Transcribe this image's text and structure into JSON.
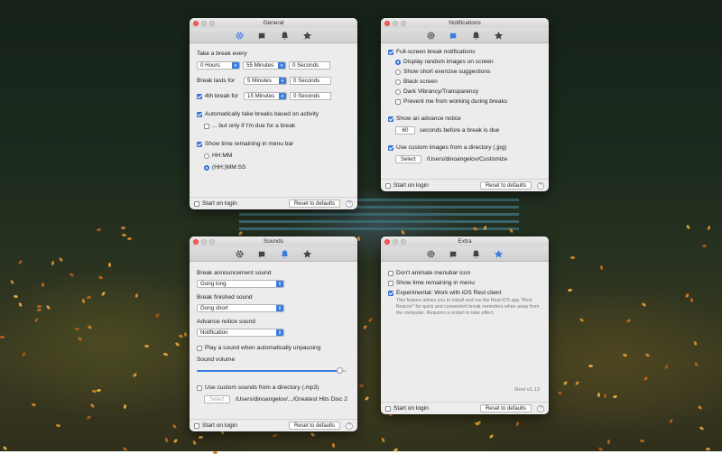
{
  "general": {
    "title": "General",
    "take_break_every_label": "Take a break every",
    "hours_value": "0 Hours",
    "minutes_value": "55 Minutes",
    "seconds_value": "0 Seconds",
    "break_lasts_label": "Break lasts for",
    "lasts_minutes_value": "5 Minutes",
    "lasts_seconds_value": "0 Seconds",
    "fourth_break_label": "4th break for",
    "fourth_minutes_value": "15 Minutes",
    "fourth_seconds_value": "0 Seconds",
    "auto_breaks_label": "Automatically take breaks based on activity",
    "only_if_due_label": "... but only if I'm due for a break",
    "show_time_label": "Show time remaining in menu bar",
    "format_hhmm": "HH:MM",
    "format_hhmmss": "(HH:)MM:SS",
    "start_on_login": "Start on login",
    "reset_defaults": "Reset to defaults",
    "help": "?"
  },
  "notifications": {
    "title": "Notifications",
    "fullscreen_label": "Full-screen break notifications",
    "opt_random_images": "Display random images on screen",
    "opt_exercise": "Show short exercise suggestions",
    "opt_black": "Black screen",
    "opt_vibrancy": "Dark Vibrancy/Transparency",
    "prevent_label": "Prevent me from working during breaks",
    "advance_notice_label": "Show an advance notice",
    "advance_seconds_value": "60",
    "advance_seconds_suffix": "seconds before a break is due",
    "custom_images_label": "Use custom images from a directory (.jpg)",
    "select_button": "Select",
    "images_path": "/Users/dinoangelov/Customize",
    "start_on_login": "Start on login",
    "reset_defaults": "Reset to defaults",
    "help": "?"
  },
  "sounds": {
    "title": "Sounds",
    "announcement_label": "Break announcement sound",
    "announcement_value": "Gong long",
    "finished_label": "Break finished sound",
    "finished_value": "Gong short",
    "advance_label": "Advance notice sound",
    "advance_value": "Notification",
    "unpausing_label": "Play a sound when automatically unpausing",
    "volume_label": "Sound volume",
    "volume_level": 0.98,
    "custom_sounds_label": "Use custom sounds from a directory (.mp3)",
    "select_button": "Select",
    "sounds_path": "/Users/dinoangelov/.../Greatest Hits Disc 2",
    "start_on_login": "Start on login",
    "reset_defaults": "Reset to defaults",
    "help": "?"
  },
  "extra": {
    "title": "Extra",
    "no_animate_label": "Don't animate menubar icon",
    "show_time_label": "Show time remaining in menu",
    "experimental_label": "Experimental: Work with iOS Rest client",
    "experimental_note": "This feature allows you to install and run the Rest iOS app \"Rest Beacon\" for quick and convenient break reminders when away from the computer. Requires a restart to take effect.",
    "version": "Rest v1.13",
    "start_on_login": "Start on login",
    "reset_defaults": "Reset to defaults",
    "help": "?"
  },
  "colors": {
    "accent": "#3b7de0",
    "close": "#ff5f57"
  },
  "icons": [
    "gear-icon",
    "notification-flag-icon",
    "bell-icon",
    "star-icon"
  ]
}
